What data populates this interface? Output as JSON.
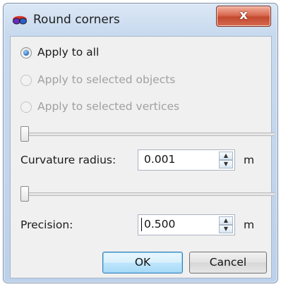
{
  "window": {
    "title": "Round corners",
    "close_glyph": "x",
    "icon": "glasses-icon"
  },
  "apply_options": [
    {
      "label": "Apply to all",
      "checked": true,
      "enabled": true
    },
    {
      "label": "Apply to selected objects",
      "checked": false,
      "enabled": false
    },
    {
      "label": "Apply to selected vertices",
      "checked": false,
      "enabled": false
    }
  ],
  "slider1": {
    "value": 0
  },
  "curvature": {
    "label": "Curvature radius:",
    "value": "0.001",
    "unit": "m"
  },
  "slider2": {
    "value": 0
  },
  "precision": {
    "label": "Precision:",
    "value": "0.500",
    "unit": "m"
  },
  "buttons": {
    "ok": "OK",
    "cancel": "Cancel"
  },
  "colors": {
    "title_bar": "#c8daee",
    "close_button": "#c8492f",
    "client": "#f0f0f0",
    "default_button": "#bee6fd"
  }
}
